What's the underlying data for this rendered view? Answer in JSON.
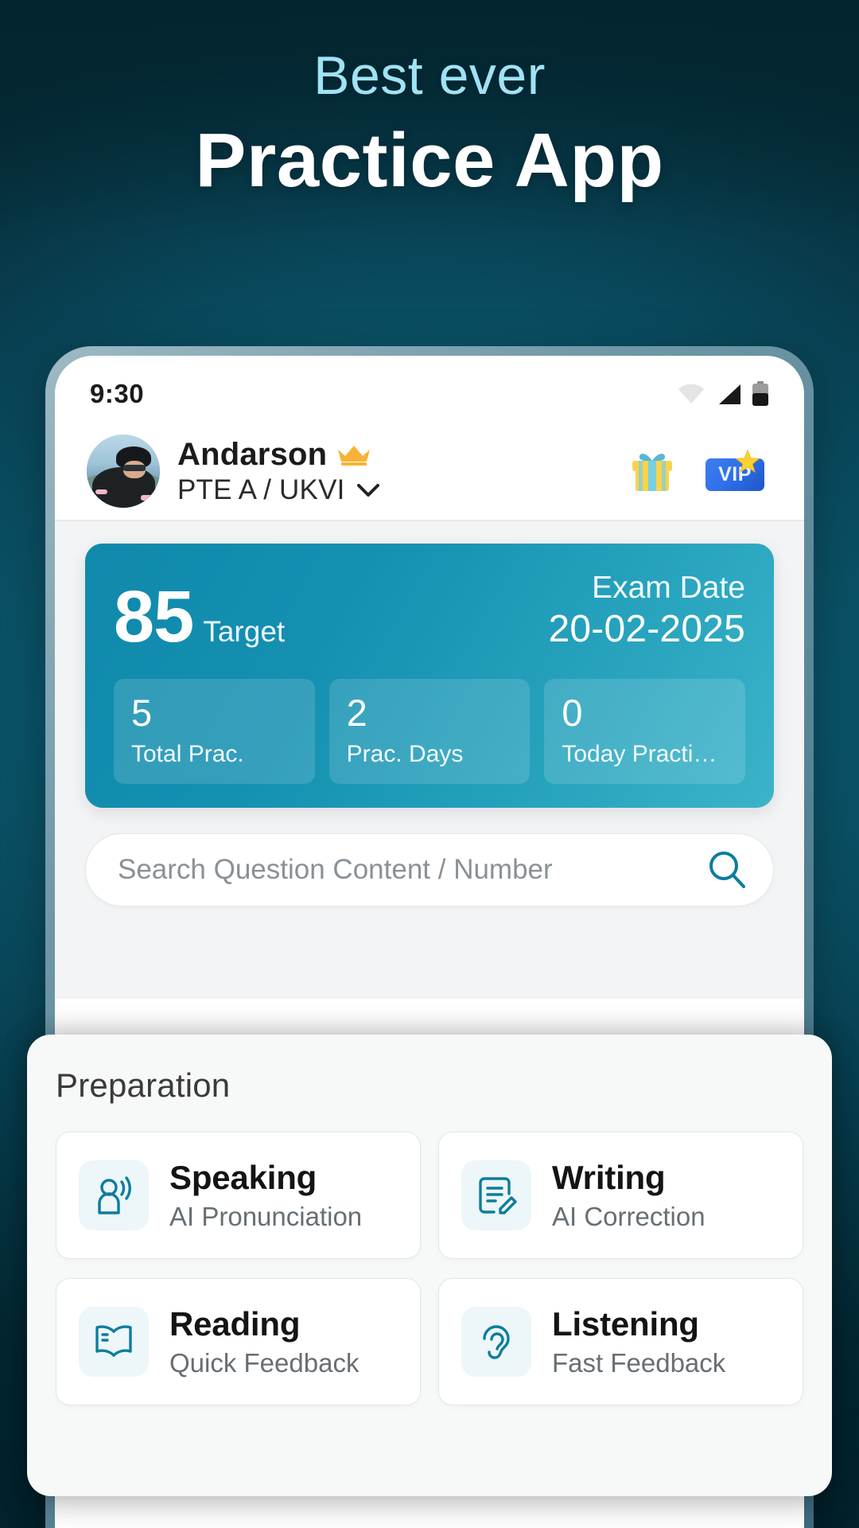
{
  "headline": {
    "sub": "Best ever",
    "main": "Practice App",
    "sub_color": "#9fe3f5",
    "main_color": "#ffffff"
  },
  "background": {
    "accent": "#0d687f",
    "dark": "#052833"
  },
  "phone": {
    "statusbar": {
      "time": "9:30",
      "icons": [
        "wifi-icon",
        "signal-icon",
        "battery-icon"
      ]
    },
    "profile": {
      "avatar_alt": "cyclist-avatar",
      "name": "Andarson",
      "badge_icon": "crown-icon",
      "subtitle": "PTE A / UKVI",
      "subtitle_chevron": "chevron-down-icon",
      "actions": [
        {
          "icon": "gift-icon",
          "label": ""
        },
        {
          "icon": "vip-badge-icon",
          "label": "VIP"
        }
      ]
    },
    "target_card": {
      "score": "85",
      "score_label": "Target",
      "exam_date_label": "Exam Date",
      "exam_date_value": "20-02-2025",
      "accent": "#1490b1",
      "stats": [
        {
          "value": "5",
          "label": "Total Prac."
        },
        {
          "value": "2",
          "label": "Prac. Days"
        },
        {
          "value": "0",
          "label": "Today Practi…"
        }
      ]
    },
    "search": {
      "placeholder": "Search Question Content / Number",
      "value": "",
      "icon": "search-icon"
    }
  },
  "preparation": {
    "title": "Preparation",
    "cards": [
      {
        "name": "Speaking",
        "desc": "AI Pronunciation",
        "icon": "speaking-icon"
      },
      {
        "name": "Writing",
        "desc": "AI Correction",
        "icon": "writing-icon"
      },
      {
        "name": "Reading",
        "desc": "Quick Feedback",
        "icon": "reading-icon"
      },
      {
        "name": "Listening",
        "desc": "Fast Feedback",
        "icon": "listening-icon"
      }
    ],
    "icon_color": "#0d7d9e"
  }
}
